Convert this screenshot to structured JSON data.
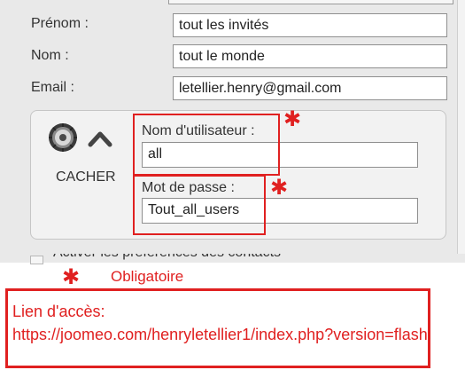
{
  "form": {
    "prenom_label": "Prénom :",
    "prenom_value": "tout les invités",
    "nom_label": "Nom :",
    "nom_value": "tout le monde",
    "email_label": "Email :",
    "email_value": "letellier.henry@gmail.com"
  },
  "login_box": {
    "hide_label": "CACHER",
    "username_label": "Nom d'utilisateur :",
    "username_value": "all",
    "password_label": "Mot de passe :",
    "password_value": "Tout_all_users"
  },
  "strip": {
    "partial_text": "Activer les préférences des contacts"
  },
  "annotation": {
    "required_mark": "✱",
    "legend_text": "Obligatoire",
    "link_label": "Lien d'accès:",
    "link_url": "https://joomeo.com/henryletellier1/index.php?version=flash",
    "annotation_color": "#e02020"
  },
  "icons": {
    "lock": "combination-lock-icon",
    "collapse": "chevron-up-icon"
  }
}
